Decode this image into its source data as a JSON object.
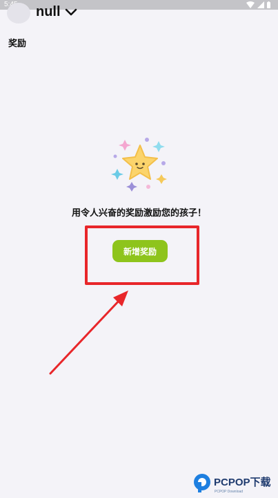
{
  "status_bar": {
    "time": "5:45"
  },
  "header": {
    "username": "null"
  },
  "section": {
    "title": "奖励"
  },
  "empty_state": {
    "message": "用令人兴奋的奖励激励您的孩子！",
    "button_label": "新增奖励"
  },
  "watermark": {
    "brand": "PCPOP下载",
    "subtitle": "PCPOP Download"
  },
  "colors": {
    "accent": "#8ec41c",
    "annotation": "#e8262a",
    "background": "#f4f3f8"
  }
}
